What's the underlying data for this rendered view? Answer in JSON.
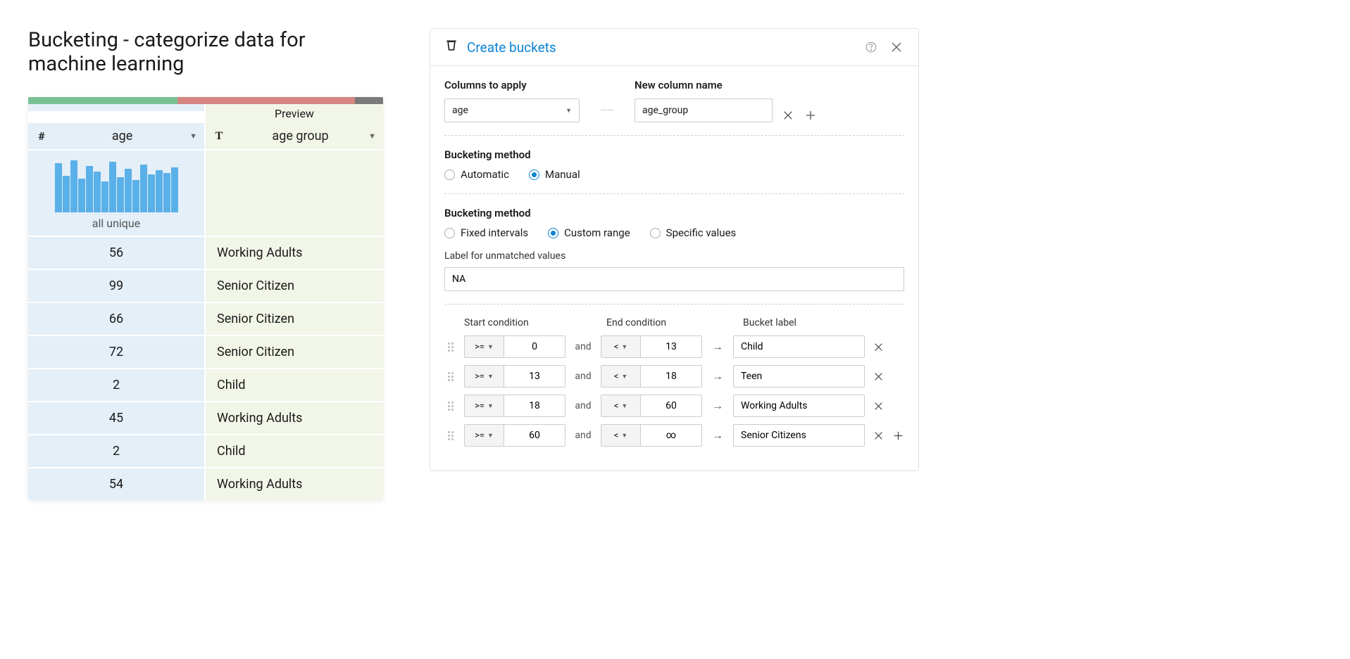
{
  "title": "Bucketing - categorize data for machine learning",
  "preview_label": "Preview",
  "columns": {
    "age": {
      "label": "age",
      "summary": "all unique"
    },
    "group": {
      "label": "age group"
    }
  },
  "rows": [
    {
      "age": "56",
      "group": "Working Adults"
    },
    {
      "age": "99",
      "group": "Senior Citizen"
    },
    {
      "age": "66",
      "group": "Senior Citizen"
    },
    {
      "age": "72",
      "group": "Senior Citizen"
    },
    {
      "age": "2",
      "group": "Child"
    },
    {
      "age": "45",
      "group": "Working Adults"
    },
    {
      "age": "2",
      "group": "Child"
    },
    {
      "age": "54",
      "group": "Working Adults"
    }
  ],
  "panel": {
    "title": "Create buckets",
    "columns_to_apply_label": "Columns to apply",
    "columns_to_apply_value": "age",
    "new_column_label": "New column name",
    "new_column_value": "age_group",
    "method_label": "Bucketing method",
    "method_options": {
      "automatic": "Automatic",
      "manual": "Manual"
    },
    "method_selected": "manual",
    "range_label": "Bucketing method",
    "range_options": {
      "fixed": "Fixed intervals",
      "custom": "Custom range",
      "specific": "Specific values"
    },
    "range_selected": "custom",
    "unmatched_label": "Label for unmatched values",
    "unmatched_value": "NA",
    "cond_headers": {
      "start": "Start condition",
      "end": "End condition",
      "bucket": "Bucket label"
    },
    "and_text": "and",
    "arrow_text": "→",
    "conditions": [
      {
        "start_op": ">=",
        "start_val": "0",
        "end_op": "<",
        "end_val": "13",
        "label": "Child"
      },
      {
        "start_op": ">=",
        "start_val": "13",
        "end_op": "<",
        "end_val": "18",
        "label": "Teen"
      },
      {
        "start_op": ">=",
        "start_val": "18",
        "end_op": "<",
        "end_val": "60",
        "label": "Working Adults"
      },
      {
        "start_op": ">=",
        "start_val": "60",
        "end_op": "<",
        "end_val": "∞",
        "label": "Senior Citizens"
      }
    ]
  },
  "histogram_bars": [
    70,
    52,
    74,
    48,
    66,
    58,
    44,
    72,
    50,
    62,
    46,
    68,
    54,
    60,
    56,
    64
  ]
}
